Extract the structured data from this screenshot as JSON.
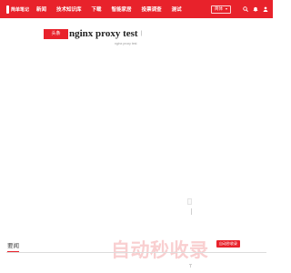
{
  "header": {
    "logo_text": "简单笔记",
    "nav_items": [
      "新闻",
      "技术知识库",
      "下载",
      "智能家居",
      "投票调查",
      "测试"
    ],
    "language": "简体",
    "accent_color": "#e8222b",
    "icons": [
      "search-icon",
      "bell-icon",
      "user-icon"
    ]
  },
  "article": {
    "tag": "头条",
    "title": "nginx proxy test",
    "subtitle": "nginx proxy test"
  },
  "footer_section": {
    "label": "要闻",
    "watermark": "自动秒收录",
    "promo_badge": "自动秒收录"
  }
}
